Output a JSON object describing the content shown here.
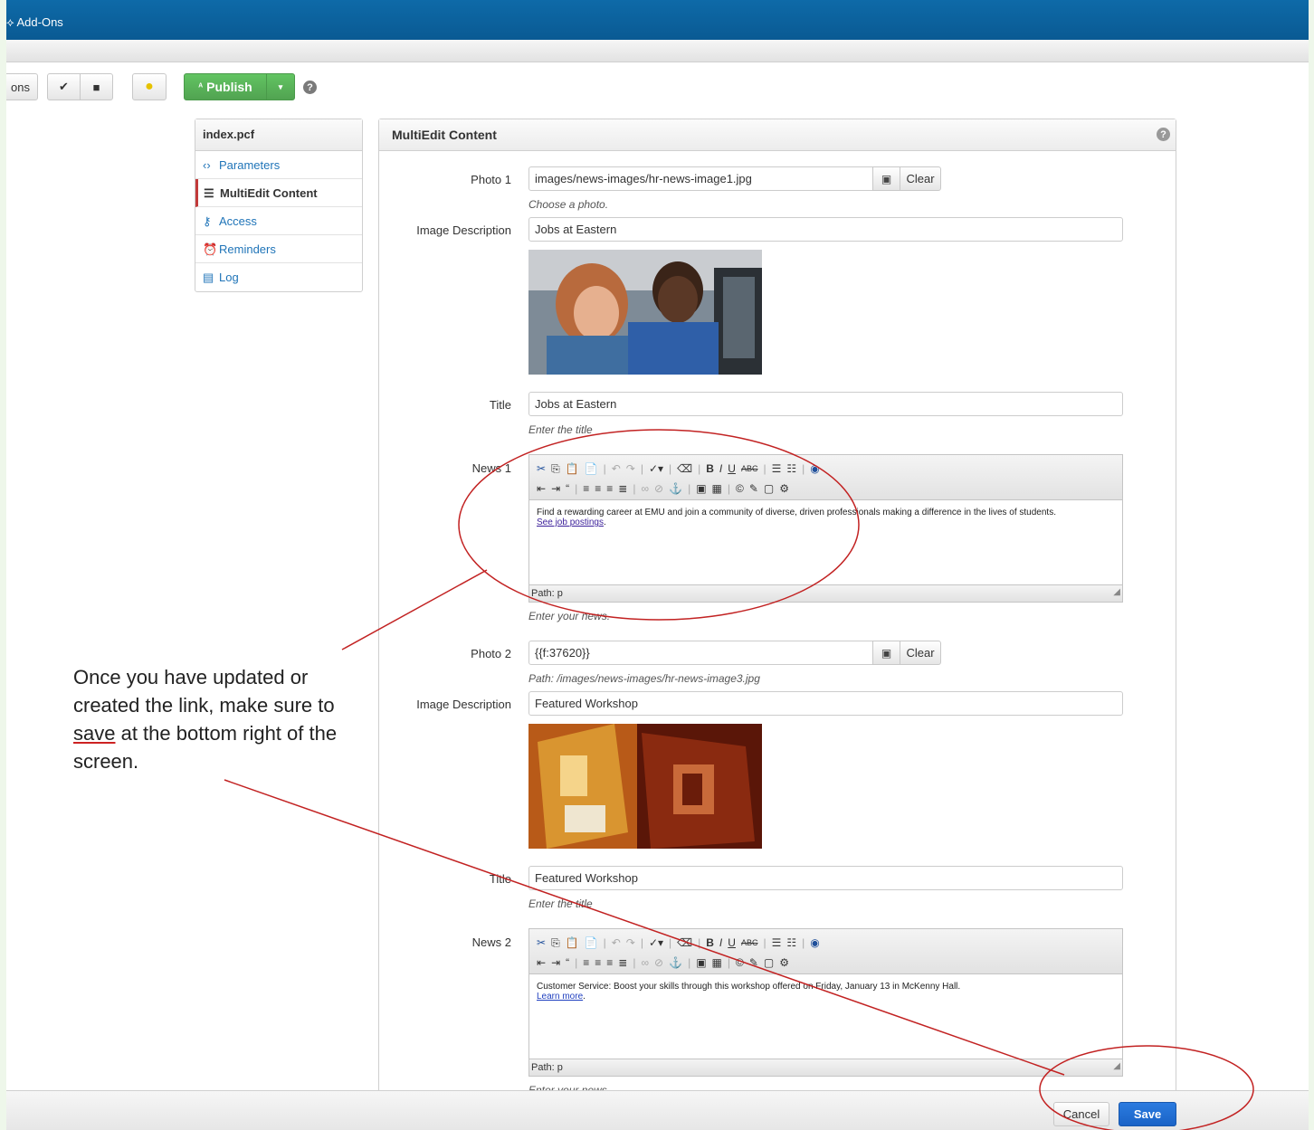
{
  "topbar": {
    "add_ons": "Add-Ons"
  },
  "toolbar": {
    "options_partial": "ons",
    "publish_label": "Publish"
  },
  "sidebar": {
    "file": "index.pcf",
    "items": [
      {
        "label": "Parameters",
        "icon": "code-icon"
      },
      {
        "label": "MultiEdit Content",
        "icon": "list-icon"
      },
      {
        "label": "Access",
        "icon": "wrench-icon"
      },
      {
        "label": "Reminders",
        "icon": "clock-icon"
      },
      {
        "label": "Log",
        "icon": "document-icon"
      }
    ]
  },
  "panel": {
    "title": "MultiEdit Content",
    "photo1": {
      "label": "Photo 1",
      "value": "images/news-images/hr-news-image1.jpg",
      "clear": "Clear",
      "hint": "Choose a photo."
    },
    "desc1": {
      "label": "Image Description",
      "value": "Jobs at Eastern"
    },
    "title1": {
      "label": "Title",
      "value": "Jobs at Eastern",
      "hint": "Enter the title"
    },
    "news1": {
      "label": "News 1",
      "text": "Find a rewarding career at EMU and join a community of diverse, driven professionals making a difference in the lives of students.",
      "link": "See job postings",
      "after": ".",
      "path": "Path: p",
      "hint": "Enter your news."
    },
    "photo2": {
      "label": "Photo 2",
      "value": "{{f:37620}}",
      "clear": "Clear",
      "hint": "Path: /images/news-images/hr-news-image3.jpg"
    },
    "desc2": {
      "label": "Image Description",
      "value": "Featured Workshop"
    },
    "title2": {
      "label": "Title",
      "value": "Featured Workshop",
      "hint": "Enter the title"
    },
    "news2": {
      "label": "News 2",
      "text": "Customer Service: Boost your skills through this workshop offered on Friday, January 13 in McKenny Hall.",
      "link": "Learn more",
      "after": ".",
      "path": "Path: p",
      "hint": "Enter your news."
    }
  },
  "footer": {
    "cancel": "Cancel",
    "save": "Save"
  },
  "annotation": {
    "before": "Once you have updated or created the link, make sure to ",
    "save_word": "save",
    "after": " at the bottom right of the screen."
  },
  "colors": {
    "topbar": "#0a5a93",
    "publish": "#51a351",
    "save": "#1a63c7",
    "annotation": "#c22222",
    "link": "#1f74b8"
  }
}
